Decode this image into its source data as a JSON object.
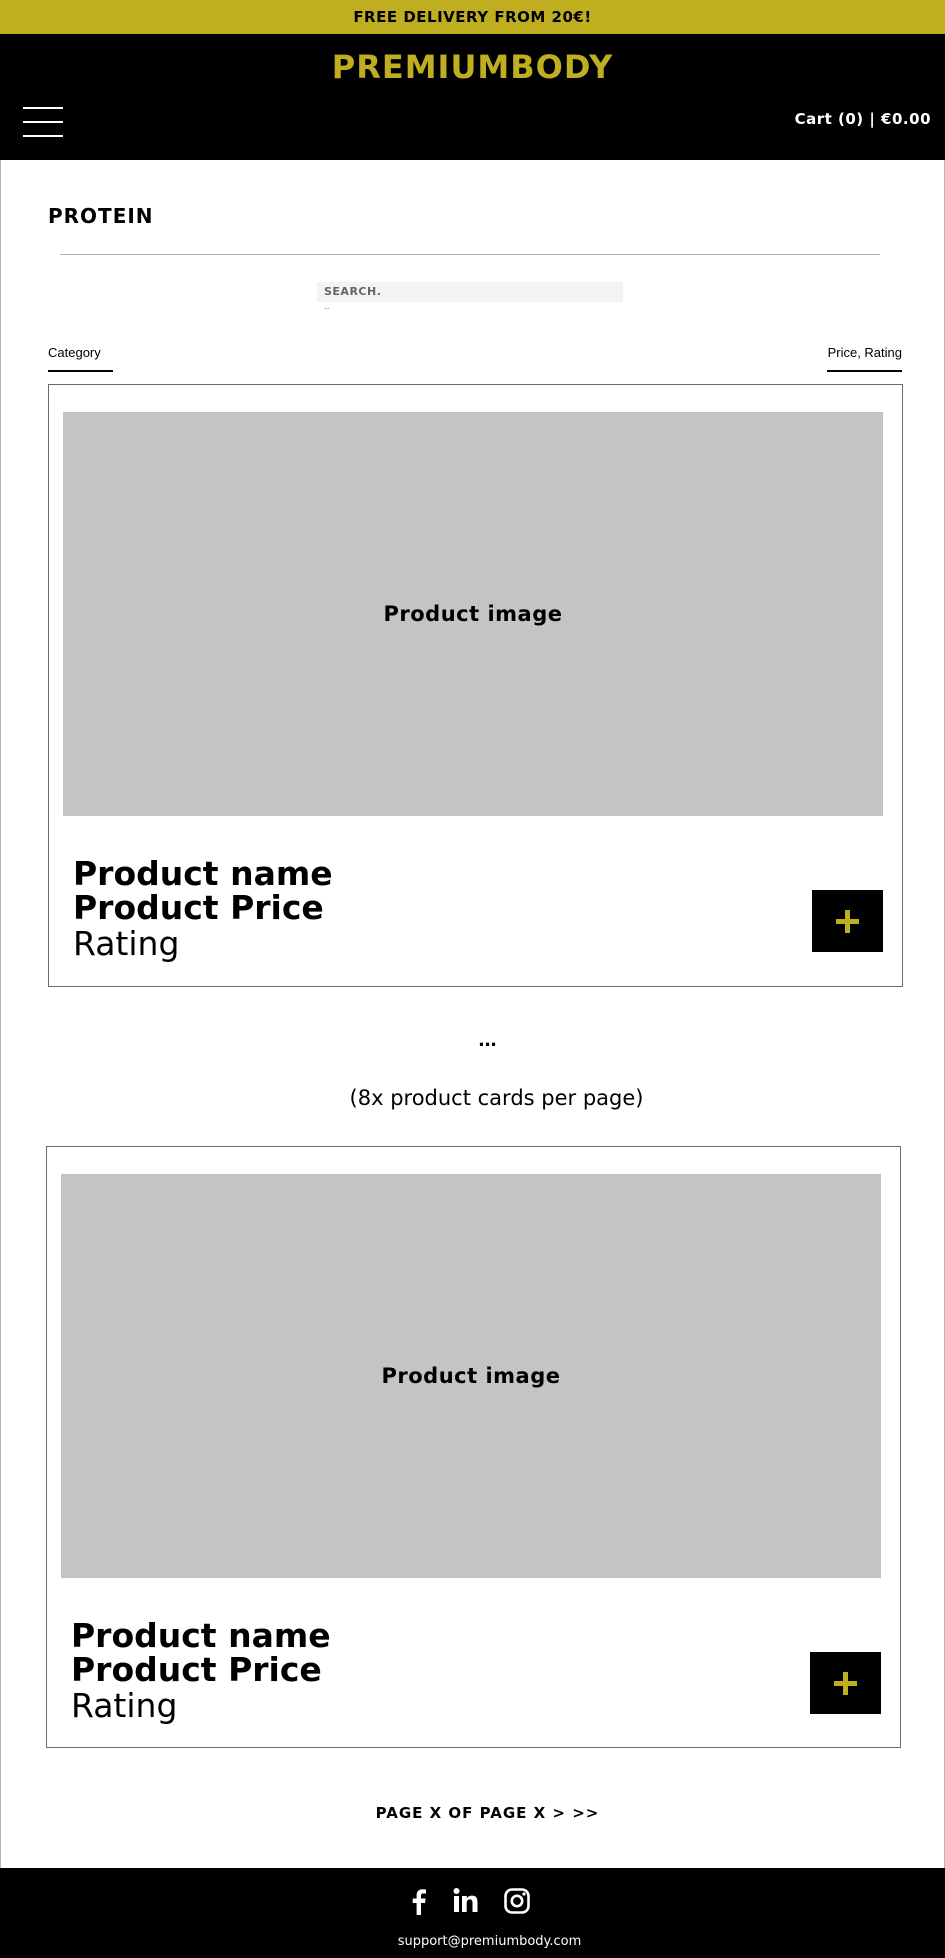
{
  "topbar": {
    "text": "FREE DELIVERY FROM 20€!"
  },
  "header": {
    "logo": "PREMIUMBODY",
    "cart": "Cart (0) | €0.00",
    "menu_icon": "hamburger-menu-icon"
  },
  "main": {
    "title": "PROTEIN",
    "search": {
      "label": "SEARCH.",
      "dots": "..",
      "placeholder": ""
    },
    "filters": {
      "category": "Category",
      "sort": "Price, Rating"
    },
    "cards": [
      {
        "image_label": "Product image",
        "name": "Product name",
        "price": "Product Price",
        "rating": "Rating",
        "add_icon": "plus-icon"
      },
      {
        "image_label": "Product image",
        "name": "Product name",
        "price": "Product Price",
        "rating": "Rating",
        "add_icon": "plus-icon"
      }
    ],
    "ellipsis": "...",
    "cards_note": "(8x product cards per page)",
    "pagination": "PAGE X OF PAGE X > >>"
  },
  "footer": {
    "social_icons": [
      "facebook-icon",
      "linkedin-icon",
      "instagram-icon"
    ],
    "email": "support@premiumbody.com"
  },
  "colors": {
    "accent": "#bfae20",
    "dark": "#000000",
    "placeholder": "#c4c4c4"
  }
}
